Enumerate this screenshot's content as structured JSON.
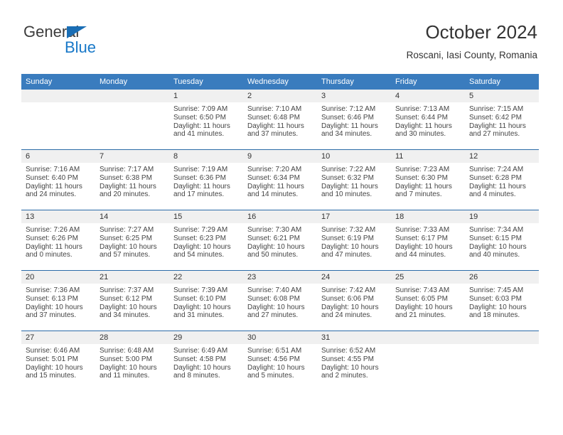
{
  "brand": {
    "name_top": "General",
    "name_bottom": "Blue",
    "accent_color": "#1878c8",
    "triangle_color": "#1a6eb5"
  },
  "header": {
    "title": "October 2024",
    "subtitle": "Roscani, Iasi County, Romania"
  },
  "calendar": {
    "header_bg": "#3a7cbe",
    "row_rule_color": "#2b6ba8",
    "daynum_bg": "#f0f0f0",
    "weekdays": [
      "Sunday",
      "Monday",
      "Tuesday",
      "Wednesday",
      "Thursday",
      "Friday",
      "Saturday"
    ],
    "labels": {
      "sunrise": "Sunrise:",
      "sunset": "Sunset:",
      "daylight": "Daylight:"
    },
    "weeks": [
      [
        {
          "day": "",
          "empty": true
        },
        {
          "day": "",
          "empty": true
        },
        {
          "day": "1",
          "sunrise": "Sunrise: 7:09 AM",
          "sunset": "Sunset: 6:50 PM",
          "daylight": "Daylight: 11 hours and 41 minutes."
        },
        {
          "day": "2",
          "sunrise": "Sunrise: 7:10 AM",
          "sunset": "Sunset: 6:48 PM",
          "daylight": "Daylight: 11 hours and 37 minutes."
        },
        {
          "day": "3",
          "sunrise": "Sunrise: 7:12 AM",
          "sunset": "Sunset: 6:46 PM",
          "daylight": "Daylight: 11 hours and 34 minutes."
        },
        {
          "day": "4",
          "sunrise": "Sunrise: 7:13 AM",
          "sunset": "Sunset: 6:44 PM",
          "daylight": "Daylight: 11 hours and 30 minutes."
        },
        {
          "day": "5",
          "sunrise": "Sunrise: 7:15 AM",
          "sunset": "Sunset: 6:42 PM",
          "daylight": "Daylight: 11 hours and 27 minutes."
        }
      ],
      [
        {
          "day": "6",
          "sunrise": "Sunrise: 7:16 AM",
          "sunset": "Sunset: 6:40 PM",
          "daylight": "Daylight: 11 hours and 24 minutes."
        },
        {
          "day": "7",
          "sunrise": "Sunrise: 7:17 AM",
          "sunset": "Sunset: 6:38 PM",
          "daylight": "Daylight: 11 hours and 20 minutes."
        },
        {
          "day": "8",
          "sunrise": "Sunrise: 7:19 AM",
          "sunset": "Sunset: 6:36 PM",
          "daylight": "Daylight: 11 hours and 17 minutes."
        },
        {
          "day": "9",
          "sunrise": "Sunrise: 7:20 AM",
          "sunset": "Sunset: 6:34 PM",
          "daylight": "Daylight: 11 hours and 14 minutes."
        },
        {
          "day": "10",
          "sunrise": "Sunrise: 7:22 AM",
          "sunset": "Sunset: 6:32 PM",
          "daylight": "Daylight: 11 hours and 10 minutes."
        },
        {
          "day": "11",
          "sunrise": "Sunrise: 7:23 AM",
          "sunset": "Sunset: 6:30 PM",
          "daylight": "Daylight: 11 hours and 7 minutes."
        },
        {
          "day": "12",
          "sunrise": "Sunrise: 7:24 AM",
          "sunset": "Sunset: 6:28 PM",
          "daylight": "Daylight: 11 hours and 4 minutes."
        }
      ],
      [
        {
          "day": "13",
          "sunrise": "Sunrise: 7:26 AM",
          "sunset": "Sunset: 6:26 PM",
          "daylight": "Daylight: 11 hours and 0 minutes."
        },
        {
          "day": "14",
          "sunrise": "Sunrise: 7:27 AM",
          "sunset": "Sunset: 6:25 PM",
          "daylight": "Daylight: 10 hours and 57 minutes."
        },
        {
          "day": "15",
          "sunrise": "Sunrise: 7:29 AM",
          "sunset": "Sunset: 6:23 PM",
          "daylight": "Daylight: 10 hours and 54 minutes."
        },
        {
          "day": "16",
          "sunrise": "Sunrise: 7:30 AM",
          "sunset": "Sunset: 6:21 PM",
          "daylight": "Daylight: 10 hours and 50 minutes."
        },
        {
          "day": "17",
          "sunrise": "Sunrise: 7:32 AM",
          "sunset": "Sunset: 6:19 PM",
          "daylight": "Daylight: 10 hours and 47 minutes."
        },
        {
          "day": "18",
          "sunrise": "Sunrise: 7:33 AM",
          "sunset": "Sunset: 6:17 PM",
          "daylight": "Daylight: 10 hours and 44 minutes."
        },
        {
          "day": "19",
          "sunrise": "Sunrise: 7:34 AM",
          "sunset": "Sunset: 6:15 PM",
          "daylight": "Daylight: 10 hours and 40 minutes."
        }
      ],
      [
        {
          "day": "20",
          "sunrise": "Sunrise: 7:36 AM",
          "sunset": "Sunset: 6:13 PM",
          "daylight": "Daylight: 10 hours and 37 minutes."
        },
        {
          "day": "21",
          "sunrise": "Sunrise: 7:37 AM",
          "sunset": "Sunset: 6:12 PM",
          "daylight": "Daylight: 10 hours and 34 minutes."
        },
        {
          "day": "22",
          "sunrise": "Sunrise: 7:39 AM",
          "sunset": "Sunset: 6:10 PM",
          "daylight": "Daylight: 10 hours and 31 minutes."
        },
        {
          "day": "23",
          "sunrise": "Sunrise: 7:40 AM",
          "sunset": "Sunset: 6:08 PM",
          "daylight": "Daylight: 10 hours and 27 minutes."
        },
        {
          "day": "24",
          "sunrise": "Sunrise: 7:42 AM",
          "sunset": "Sunset: 6:06 PM",
          "daylight": "Daylight: 10 hours and 24 minutes."
        },
        {
          "day": "25",
          "sunrise": "Sunrise: 7:43 AM",
          "sunset": "Sunset: 6:05 PM",
          "daylight": "Daylight: 10 hours and 21 minutes."
        },
        {
          "day": "26",
          "sunrise": "Sunrise: 7:45 AM",
          "sunset": "Sunset: 6:03 PM",
          "daylight": "Daylight: 10 hours and 18 minutes."
        }
      ],
      [
        {
          "day": "27",
          "sunrise": "Sunrise: 6:46 AM",
          "sunset": "Sunset: 5:01 PM",
          "daylight": "Daylight: 10 hours and 15 minutes."
        },
        {
          "day": "28",
          "sunrise": "Sunrise: 6:48 AM",
          "sunset": "Sunset: 5:00 PM",
          "daylight": "Daylight: 10 hours and 11 minutes."
        },
        {
          "day": "29",
          "sunrise": "Sunrise: 6:49 AM",
          "sunset": "Sunset: 4:58 PM",
          "daylight": "Daylight: 10 hours and 8 minutes."
        },
        {
          "day": "30",
          "sunrise": "Sunrise: 6:51 AM",
          "sunset": "Sunset: 4:56 PM",
          "daylight": "Daylight: 10 hours and 5 minutes."
        },
        {
          "day": "31",
          "sunrise": "Sunrise: 6:52 AM",
          "sunset": "Sunset: 4:55 PM",
          "daylight": "Daylight: 10 hours and 2 minutes."
        },
        {
          "day": "",
          "empty": true
        },
        {
          "day": "",
          "empty": true
        }
      ]
    ]
  }
}
